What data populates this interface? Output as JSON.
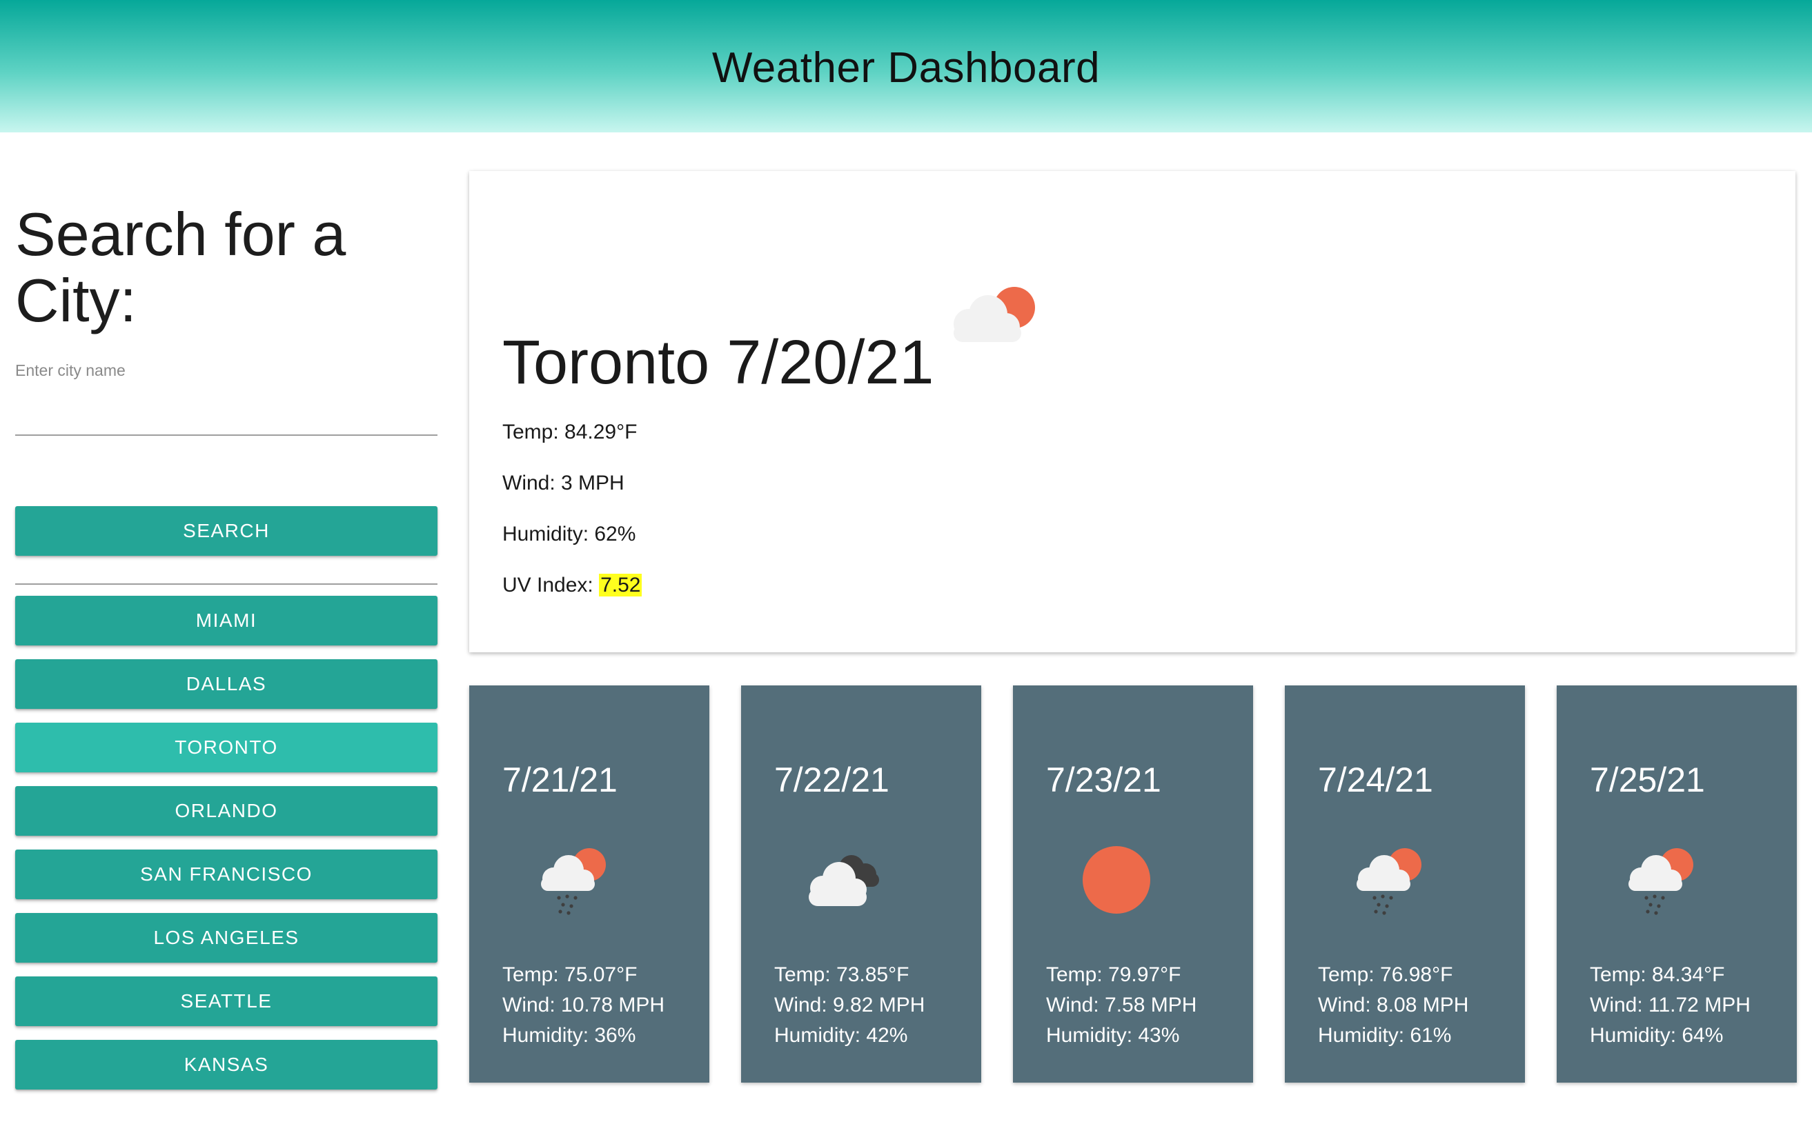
{
  "header": {
    "title": "Weather Dashboard"
  },
  "sidebar": {
    "heading": "Search for a City:",
    "input_label": "Enter city name",
    "input_value": "",
    "search_label": "SEARCH",
    "history": [
      {
        "label": "MIAMI",
        "active": false
      },
      {
        "label": "DALLAS",
        "active": false
      },
      {
        "label": "TORONTO",
        "active": true
      },
      {
        "label": "ORLANDO",
        "active": false
      },
      {
        "label": "SAN FRANCISCO",
        "active": false
      },
      {
        "label": "LOS ANGELES",
        "active": false
      },
      {
        "label": "SEATTLE",
        "active": false
      },
      {
        "label": "KANSAS",
        "active": false
      }
    ]
  },
  "current": {
    "title": "Toronto 7/20/21",
    "icon": "sun-behind-cloud-icon",
    "temp": "Temp: 84.29°F",
    "wind": "Wind: 3 MPH",
    "humidity": "Humidity: 62%",
    "uv_label": "UV Index: ",
    "uv_value": "7.52",
    "uv_color": "#ffff1e"
  },
  "forecast": [
    {
      "date": "7/21/21",
      "icon": "sun-cloud-rain-icon",
      "temp": "Temp: 75.07°F",
      "wind": "Wind: 10.78 MPH",
      "humidity": "Humidity: 36%"
    },
    {
      "date": "7/22/21",
      "icon": "broken-clouds-icon",
      "temp": "Temp: 73.85°F",
      "wind": "Wind: 9.82 MPH",
      "humidity": "Humidity: 42%"
    },
    {
      "date": "7/23/21",
      "icon": "sun-icon",
      "temp": "Temp: 79.97°F",
      "wind": "Wind: 7.58 MPH",
      "humidity": "Humidity: 43%"
    },
    {
      "date": "7/24/21",
      "icon": "sun-cloud-rain-icon",
      "temp": "Temp: 76.98°F",
      "wind": "Wind: 8.08 MPH",
      "humidity": "Humidity: 61%"
    },
    {
      "date": "7/25/21",
      "icon": "sun-cloud-rain-icon",
      "temp": "Temp: 84.34°F",
      "wind": "Wind: 11.72 MPH",
      "humidity": "Humidity: 64%"
    }
  ],
  "colors": {
    "accent": "#24a596",
    "accent_active": "#2ebdac",
    "forecast_card": "#546e7a",
    "sun": "#ed6a4a",
    "cloud": "#f2f2f2",
    "dark_cloud": "#3f3f3f"
  }
}
